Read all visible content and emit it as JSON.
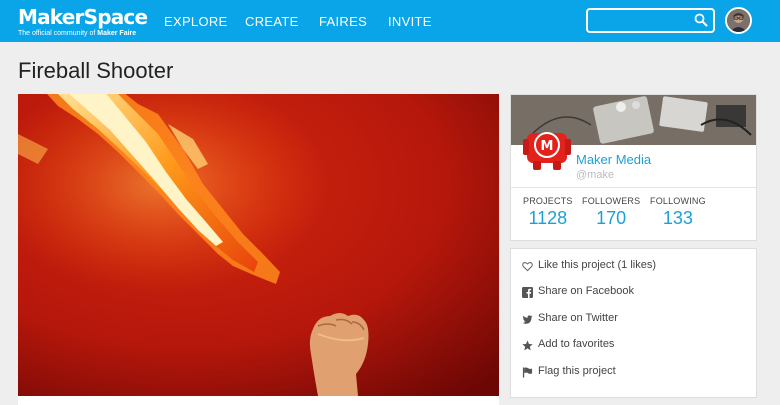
{
  "header": {
    "logo": "MakerSpace",
    "tagline_prefix": "The official community of ",
    "tagline_strong": "Maker Faire",
    "nav": [
      {
        "label": "EXPLORE"
      },
      {
        "label": "CREATE"
      },
      {
        "label": "FAIRES"
      },
      {
        "label": "INVITE"
      }
    ],
    "search": {
      "placeholder": "",
      "value": ""
    }
  },
  "page": {
    "title": "Fireball Shooter"
  },
  "profile": {
    "name": "Maker Media",
    "handle": "@make",
    "stats": [
      {
        "label": "PROJECTS",
        "value": "1128"
      },
      {
        "label": "FOLLOWERS",
        "value": "170"
      },
      {
        "label": "FOLLOWING",
        "value": "133"
      }
    ]
  },
  "actions": [
    {
      "icon": "heart-icon",
      "label": "Like this project (1 likes)"
    },
    {
      "icon": "facebook-icon",
      "label": "Share on Facebook"
    },
    {
      "icon": "twitter-icon",
      "label": "Share on Twitter"
    },
    {
      "icon": "star-icon",
      "label": "Add to favorites"
    },
    {
      "icon": "flag-icon",
      "label": "Flag this project"
    }
  ],
  "colors": {
    "brand": "#0aa5e8",
    "link": "#1e9fd8",
    "background": "#eeeeee"
  }
}
